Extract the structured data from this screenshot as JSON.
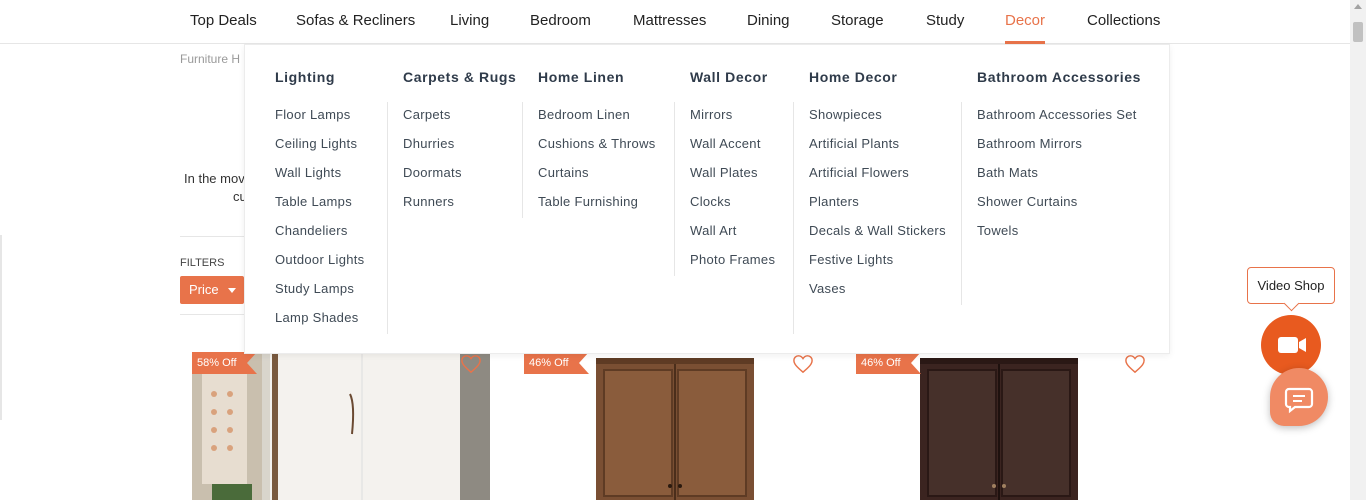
{
  "nav": {
    "items": [
      {
        "label": "Top Deals"
      },
      {
        "label": "Sofas & Recliners"
      },
      {
        "label": "Living"
      },
      {
        "label": "Bedroom"
      },
      {
        "label": "Mattresses"
      },
      {
        "label": "Dining"
      },
      {
        "label": "Storage"
      },
      {
        "label": "Study"
      },
      {
        "label": "Decor",
        "active": true
      },
      {
        "label": "Collections"
      }
    ]
  },
  "page": {
    "breadcrumb": "Furniture H",
    "description_line1": "In the mov",
    "description_line2": "cu",
    "filters_label": "FILTERS",
    "price_label": "Price"
  },
  "mega_menu": {
    "columns": [
      {
        "heading": "Lighting",
        "links": [
          "Floor Lamps",
          "Ceiling Lights",
          "Wall Lights",
          "Table Lamps",
          "Chandeliers",
          "Outdoor Lights",
          "Study Lamps",
          "Lamp Shades"
        ]
      },
      {
        "heading": "Carpets & Rugs",
        "links": [
          "Carpets",
          "Dhurries",
          "Doormats",
          "Runners"
        ]
      },
      {
        "heading": "Home Linen",
        "links": [
          "Bedroom Linen",
          "Cushions & Throws",
          "Curtains",
          "Table Furnishing"
        ]
      },
      {
        "heading": "Wall Decor",
        "links": [
          "Mirrors",
          "Wall Accent",
          "Wall Plates",
          "Clocks",
          "Wall Art",
          "Photo Frames"
        ]
      },
      {
        "heading": "Home Decor",
        "links": [
          "Showpieces",
          "Artificial Plants",
          "Artificial Flowers",
          "Planters",
          "Decals & Wall Stickers",
          "Festive Lights",
          "Vases"
        ]
      },
      {
        "heading": "Bathroom Accessories",
        "links": [
          "Bathroom Accessories Set",
          "Bathroom Mirrors",
          "Bath Mats",
          "Shower Curtains",
          "Towels"
        ]
      }
    ]
  },
  "products": [
    {
      "discount": "58% Off"
    },
    {
      "discount": "46% Off"
    },
    {
      "discount": "46% Off"
    }
  ],
  "widgets": {
    "video_shop_label": "Video Shop"
  },
  "colors": {
    "accent": "#e8734a",
    "video_button": "#e85a1f",
    "chat_button": "#f08a64"
  },
  "icons": {
    "wishlist": "heart-outline-icon",
    "video": "video-camera-icon",
    "chat": "chat-bubble-icon",
    "price_dropdown": "caret-down-icon"
  }
}
